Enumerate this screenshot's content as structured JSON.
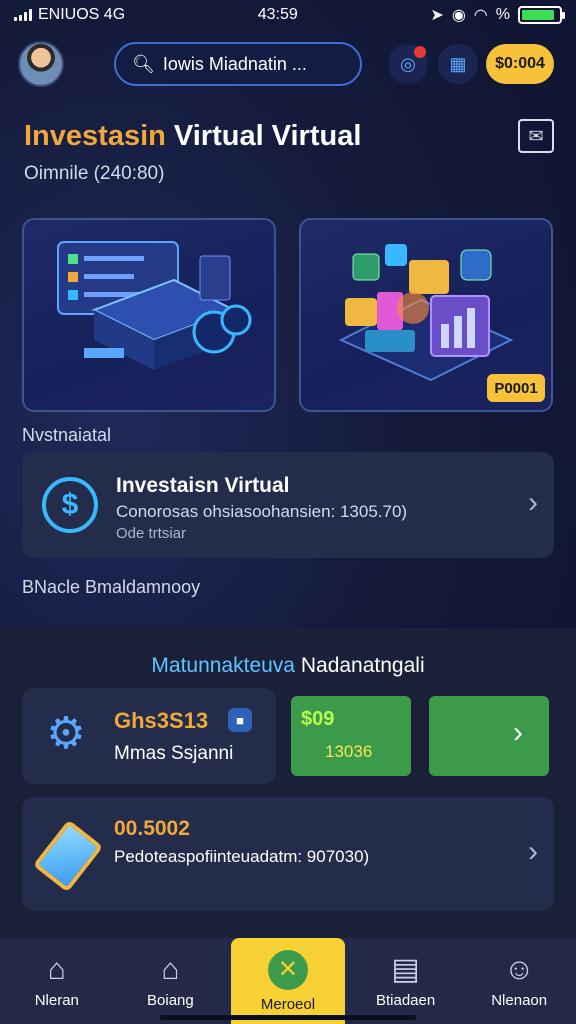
{
  "status": {
    "carrier": "ENIUOS 4G",
    "time": "43:59",
    "battery_text": "%",
    "battery_level": 0.9
  },
  "header": {
    "search_text": "Iowis Miadnatin ...",
    "coin_label": "$0:004"
  },
  "page": {
    "title_accent": "Investasin",
    "title_rest": "Virtual Virtual",
    "subtitle": "Oimnile (240:80)"
  },
  "showcase": {
    "price_tag": "P0001"
  },
  "section_labels": {
    "first": "Nvstnaiatal",
    "second": "BNacle Bmaldamnooy"
  },
  "invest_card": {
    "title": "Investaisn Virtual",
    "description": "Conorosas ohsiasoohansien: 1305.70)",
    "sub": "Ode trtsiar"
  },
  "promo": {
    "title_accent": "Matunnakteuva",
    "title_rest": "Nadanatngali"
  },
  "stat_card": {
    "value": "Ghs3S13",
    "label": "Mmas Ssjanni"
  },
  "green_box": {
    "value1": "$09",
    "value2": "13036"
  },
  "phone_card": {
    "value": "00.5002",
    "description": "Pedoteaspofiinteuadatm: 907030)"
  },
  "nav": [
    {
      "label": "Nleran",
      "icon": "home-icon"
    },
    {
      "label": "Boiang",
      "icon": "house-icon"
    },
    {
      "label": "Meroeol",
      "icon": "compass-icon",
      "active": true
    },
    {
      "label": "Btiadaen",
      "icon": "document-icon"
    },
    {
      "label": "Nlenaon",
      "icon": "smiley-icon"
    }
  ],
  "colors": {
    "accent": "#f0a83a",
    "highlight": "#f7c23a",
    "blue": "#38b8ff",
    "green": "#3c9b4a",
    "nav_active": "#f7d034"
  }
}
